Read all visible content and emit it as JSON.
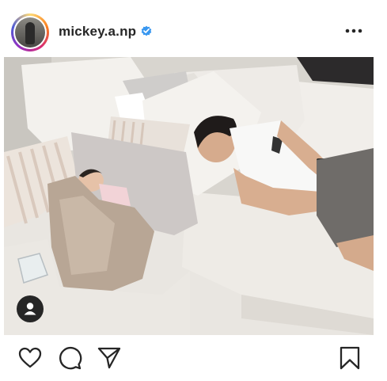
{
  "post": {
    "username": "mickey.a.np",
    "verified": true
  },
  "icons": {
    "verified": "verified-badge-icon",
    "more": "more-options-icon",
    "user_tag": "user-tag-icon",
    "like": "heart-icon",
    "comment": "comment-icon",
    "share": "share-icon",
    "save": "bookmark-icon"
  },
  "colors": {
    "verified": "#3897f0",
    "text": "#262626",
    "background": "#ffffff"
  }
}
